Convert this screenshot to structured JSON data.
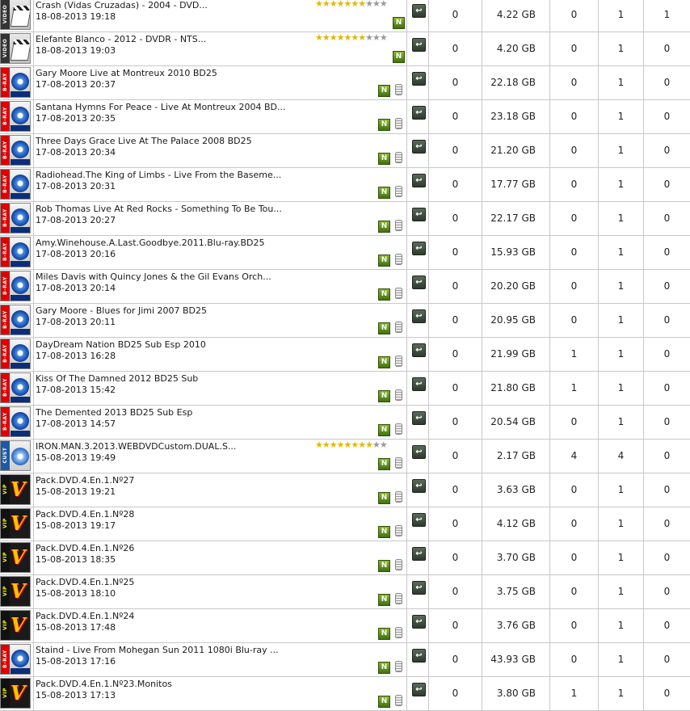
{
  "rows": [
    {
      "cat": "video",
      "cat_label": "VIDEO",
      "title": "Crash (Vidas Cruzadas) - 2004 - DVD...",
      "date": "18-08-2013 19:18",
      "rating": 7,
      "n": true,
      "hdd": false,
      "a": "0",
      "size": "4.22 GB",
      "b": "0",
      "c": "1",
      "d": "1"
    },
    {
      "cat": "video",
      "cat_label": "VIDEO",
      "title": "Elefante Blanco - 2012 - DVDR - NTS...",
      "date": "18-08-2013 19:03",
      "rating": 7,
      "n": true,
      "hdd": false,
      "a": "0",
      "size": "4.20 GB",
      "b": "0",
      "c": "1",
      "d": "0"
    },
    {
      "cat": "bluray",
      "cat_label": "B-RAY",
      "title": "Gary Moore Live at Montreux 2010 BD25",
      "date": "17-08-2013 20:37",
      "rating": 0,
      "n": true,
      "hdd": true,
      "a": "0",
      "size": "22.18 GB",
      "b": "0",
      "c": "1",
      "d": "0"
    },
    {
      "cat": "bluray",
      "cat_label": "B-RAY",
      "title": "Santana Hymns For Peace - Live At Montreux 2004 BD...",
      "date": "17-08-2013 20:35",
      "rating": 0,
      "n": true,
      "hdd": true,
      "a": "0",
      "size": "23.18 GB",
      "b": "0",
      "c": "1",
      "d": "0"
    },
    {
      "cat": "bluray",
      "cat_label": "B-RAY",
      "title": "Three Days Grace Live At The Palace 2008 BD25",
      "date": "17-08-2013 20:34",
      "rating": 0,
      "n": true,
      "hdd": true,
      "a": "0",
      "size": "21.20 GB",
      "b": "0",
      "c": "1",
      "d": "0"
    },
    {
      "cat": "bluray",
      "cat_label": "B-RAY",
      "title": "Radiohead.The King of Limbs - Live From the Baseme...",
      "date": "17-08-2013 20:31",
      "rating": 0,
      "n": true,
      "hdd": true,
      "a": "0",
      "size": "17.77 GB",
      "b": "0",
      "c": "1",
      "d": "0"
    },
    {
      "cat": "bluray",
      "cat_label": "B-RAY",
      "title": "Rob Thomas Live At Red Rocks - Something To Be Tou...",
      "date": "17-08-2013 20:27",
      "rating": 0,
      "n": true,
      "hdd": true,
      "a": "0",
      "size": "22.17 GB",
      "b": "0",
      "c": "1",
      "d": "0"
    },
    {
      "cat": "bluray",
      "cat_label": "B-RAY",
      "title": "Amy.Winehouse.A.Last.Goodbye.2011.Blu-ray.BD25",
      "date": "17-08-2013 20:16",
      "rating": 0,
      "n": true,
      "hdd": true,
      "a": "0",
      "size": "15.93 GB",
      "b": "0",
      "c": "1",
      "d": "0"
    },
    {
      "cat": "bluray",
      "cat_label": "B-RAY",
      "title": "Miles Davis with Quincy Jones & the Gil Evans Orch...",
      "date": "17-08-2013 20:14",
      "rating": 0,
      "n": true,
      "hdd": true,
      "a": "0",
      "size": "20.20 GB",
      "b": "0",
      "c": "1",
      "d": "0"
    },
    {
      "cat": "bluray",
      "cat_label": "B-RAY",
      "title": "Gary Moore - Blues for Jimi 2007 BD25",
      "date": "17-08-2013 20:11",
      "rating": 0,
      "n": true,
      "hdd": true,
      "a": "0",
      "size": "20.95 GB",
      "b": "0",
      "c": "1",
      "d": "0"
    },
    {
      "cat": "bluray",
      "cat_label": "B-RAY",
      "title": "DayDream Nation BD25 Sub Esp 2010",
      "date": "17-08-2013 16:28",
      "rating": 0,
      "n": true,
      "hdd": true,
      "a": "0",
      "size": "21.99 GB",
      "b": "1",
      "c": "1",
      "d": "0"
    },
    {
      "cat": "bluray",
      "cat_label": "B-RAY",
      "title": "Kiss Of The Damned 2012 BD25 Sub",
      "date": "17-08-2013 15:42",
      "rating": 0,
      "n": true,
      "hdd": true,
      "a": "0",
      "size": "21.80 GB",
      "b": "1",
      "c": "1",
      "d": "0"
    },
    {
      "cat": "bluray",
      "cat_label": "B-RAY",
      "title": "The Demented 2013 BD25 Sub Esp",
      "date": "17-08-2013 14:57",
      "rating": 0,
      "n": true,
      "hdd": true,
      "a": "0",
      "size": "20.54 GB",
      "b": "0",
      "c": "1",
      "d": "0"
    },
    {
      "cat": "cust",
      "cat_label": "CUST",
      "title": "IRON.MAN.3.2013.WEBDVDCustom.DUAL.S...",
      "date": "15-08-2013 19:49",
      "rating": 8,
      "n": true,
      "hdd": true,
      "a": "0",
      "size": "2.17 GB",
      "b": "4",
      "c": "4",
      "d": "0"
    },
    {
      "cat": "vip",
      "cat_label": "VIP",
      "title": "Pack.DVD.4.En.1.Nº27",
      "date": "15-08-2013 19:21",
      "rating": 0,
      "n": true,
      "hdd": true,
      "a": "0",
      "size": "3.63 GB",
      "b": "0",
      "c": "1",
      "d": "0"
    },
    {
      "cat": "vip",
      "cat_label": "VIP",
      "title": "Pack.DVD.4.En.1.Nº28",
      "date": "15-08-2013 19:17",
      "rating": 0,
      "n": true,
      "hdd": true,
      "a": "0",
      "size": "4.12 GB",
      "b": "0",
      "c": "1",
      "d": "0"
    },
    {
      "cat": "vip",
      "cat_label": "VIP",
      "title": "Pack.DVD.4.En.1.Nº26",
      "date": "15-08-2013 18:35",
      "rating": 0,
      "n": true,
      "hdd": true,
      "a": "0",
      "size": "3.70 GB",
      "b": "0",
      "c": "1",
      "d": "0"
    },
    {
      "cat": "vip",
      "cat_label": "VIP",
      "title": "Pack.DVD.4.En.1.Nº25",
      "date": "15-08-2013 18:10",
      "rating": 0,
      "n": true,
      "hdd": true,
      "a": "0",
      "size": "3.75 GB",
      "b": "0",
      "c": "1",
      "d": "0"
    },
    {
      "cat": "vip",
      "cat_label": "VIP",
      "title": "Pack.DVD.4.En.1.Nº24",
      "date": "15-08-2013 17:48",
      "rating": 0,
      "n": true,
      "hdd": true,
      "a": "0",
      "size": "3.76 GB",
      "b": "0",
      "c": "1",
      "d": "0"
    },
    {
      "cat": "bluray",
      "cat_label": "B-RAY",
      "title": "Staind - Live From Mohegan Sun 2011 1080i Blu-ray ...",
      "date": "15-08-2013 17:16",
      "rating": 0,
      "n": true,
      "hdd": true,
      "a": "0",
      "size": "43.93 GB",
      "b": "0",
      "c": "1",
      "d": "0"
    },
    {
      "cat": "vip",
      "cat_label": "VIP",
      "title": "Pack.DVD.4.En.1.Nº23.Monitos",
      "date": "15-08-2013 17:13",
      "rating": 0,
      "n": true,
      "hdd": true,
      "a": "0",
      "size": "3.80 GB",
      "b": "1",
      "c": "1",
      "d": "0"
    }
  ],
  "icons": {
    "n_glyph": "N",
    "download_glyph": "↩",
    "star_on": "★",
    "star_off": "★",
    "stars_total": 10
  }
}
